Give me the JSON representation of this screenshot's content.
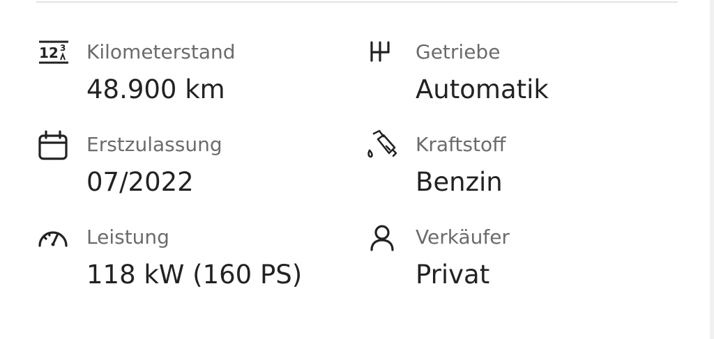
{
  "specs": {
    "mileage": {
      "icon": "odometer-icon",
      "label": "Kilometerstand",
      "value": "48.900 km",
      "icon_glyph_top": "12",
      "icon_glyph_side": "3"
    },
    "gearbox": {
      "icon": "gearshift-icon",
      "label": "Getriebe",
      "value": "Automatik"
    },
    "first_registration": {
      "icon": "calendar-icon",
      "label": "Erstzulassung",
      "value": "07/2022"
    },
    "fuel": {
      "icon": "fuel-nozzle-icon",
      "label": "Kraftstoff",
      "value": "Benzin"
    },
    "power": {
      "icon": "speedometer-icon",
      "label": "Leistung",
      "value": "118 kW (160 PS)"
    },
    "seller": {
      "icon": "person-icon",
      "label": "Verkäufer",
      "value": "Privat"
    }
  },
  "colors": {
    "label": "#6b6b6b",
    "value": "#222222",
    "icon": "#222222",
    "divider": "#e3e3e3"
  }
}
